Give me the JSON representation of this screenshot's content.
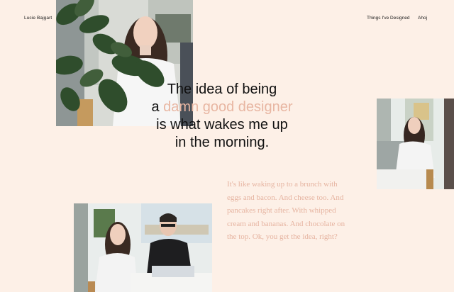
{
  "header": {
    "brand": "Lucie Bajgart",
    "nav": [
      {
        "label": "Things I've Designed"
      },
      {
        "label": "Ahoj"
      }
    ]
  },
  "hero": {
    "line1": "The idea of being",
    "line2_prefix": "a",
    "line2_accent": "damn good designer",
    "line3": "is what wakes me up",
    "line4": "in the morning."
  },
  "intro": {
    "text": "It's like waking up to a brunch with eggs and bacon. And cheese too. And pancakes right after. With whipped cream and bananas. And chocolate on the top. Ok, you get the idea, right?"
  },
  "colors": {
    "background": "#fdf0e7",
    "accent": "#e8b6a2",
    "text": "#111111"
  }
}
